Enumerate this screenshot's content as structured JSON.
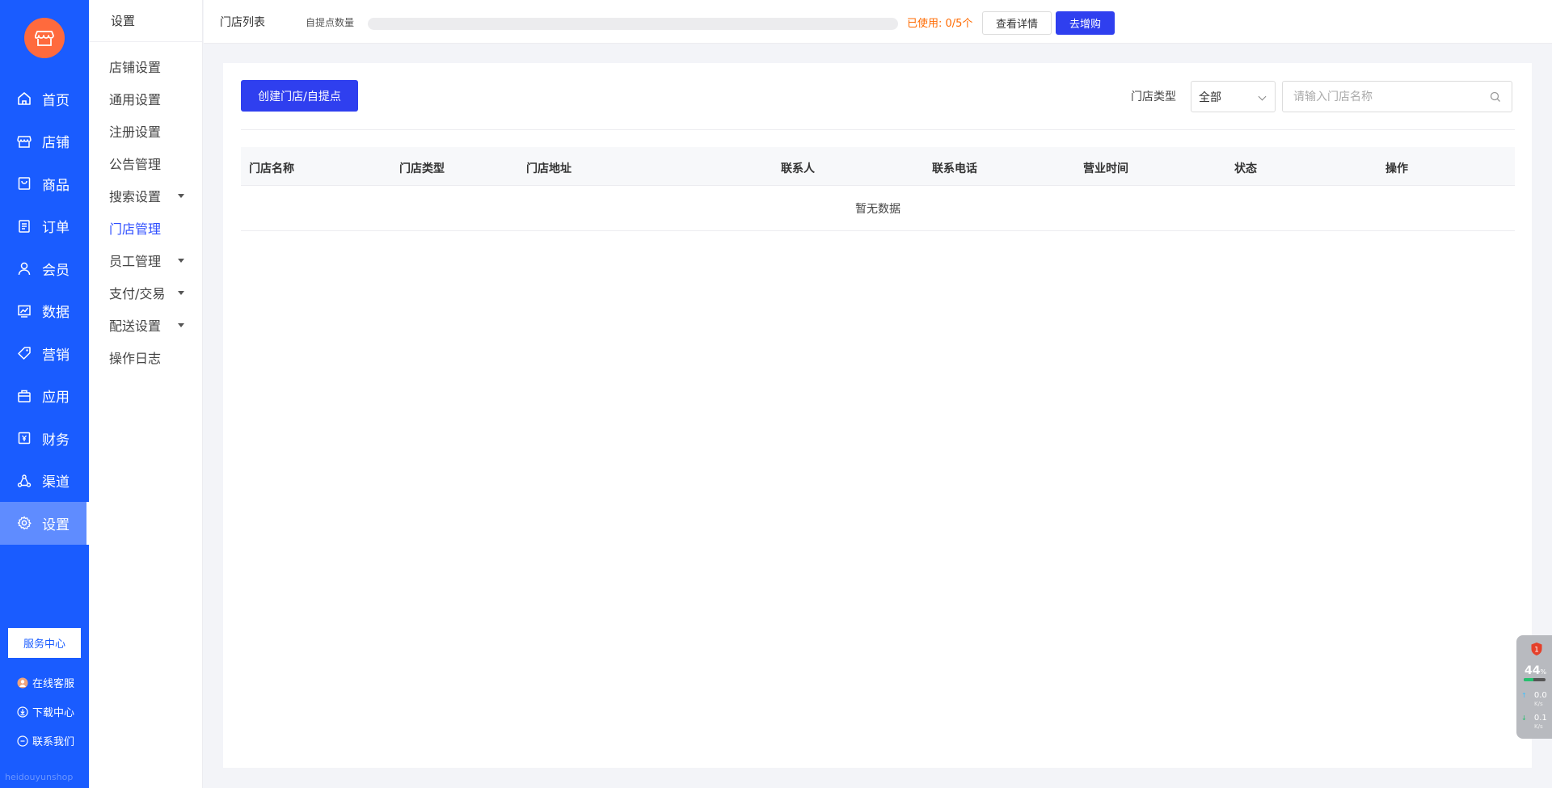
{
  "nav": {
    "items": [
      {
        "label": "首页",
        "icon": "home-icon"
      },
      {
        "label": "店铺",
        "icon": "store-icon"
      },
      {
        "label": "商品",
        "icon": "goods-icon"
      },
      {
        "label": "订单",
        "icon": "order-icon"
      },
      {
        "label": "会员",
        "icon": "user-icon"
      },
      {
        "label": "数据",
        "icon": "chart-icon"
      },
      {
        "label": "营销",
        "icon": "tag-icon"
      },
      {
        "label": "应用",
        "icon": "app-icon"
      },
      {
        "label": "财务",
        "icon": "finance-icon"
      },
      {
        "label": "渠道",
        "icon": "channel-icon"
      },
      {
        "label": "设置",
        "icon": "gear-icon",
        "active": true
      }
    ],
    "service_center": "服务中心",
    "links": [
      "在线客服",
      "下载中心",
      "联系我们"
    ],
    "footer_text": "heidouyunshop",
    "accent_color": "#1a5cff"
  },
  "submenu": {
    "title": "设置",
    "items": [
      {
        "label": "店铺设置"
      },
      {
        "label": "通用设置"
      },
      {
        "label": "注册设置"
      },
      {
        "label": "公告管理"
      },
      {
        "label": "搜索设置",
        "has_caret": true
      },
      {
        "label": "门店管理",
        "active": true
      },
      {
        "label": "员工管理",
        "has_caret": true
      },
      {
        "label": "支付/交易",
        "has_caret": true
      },
      {
        "label": "配送设置",
        "has_caret": true
      },
      {
        "label": "操作日志"
      }
    ]
  },
  "topbar": {
    "title": "门店列表",
    "count_label": "自提点数量",
    "usage_fraction": 0,
    "used_text": "已使用: 0/5个",
    "detail_button": "查看详情",
    "buy_button": "去增购"
  },
  "main": {
    "create_button": "创建门店/自提点",
    "filter_label": "门店类型",
    "filter_value": "全部",
    "search_placeholder": "请输入门店名称",
    "columns": [
      "门店名称",
      "门店类型",
      "门店地址",
      "联系人",
      "联系电话",
      "营业时间",
      "状态",
      "操作"
    ],
    "empty_text": "暂无数据"
  },
  "widget": {
    "badge_count": "1",
    "percent": "44",
    "percent_unit": "%",
    "usage_fraction": 0.44,
    "upload": "0.0",
    "download": "0.1",
    "speed_unit": "K/s"
  }
}
